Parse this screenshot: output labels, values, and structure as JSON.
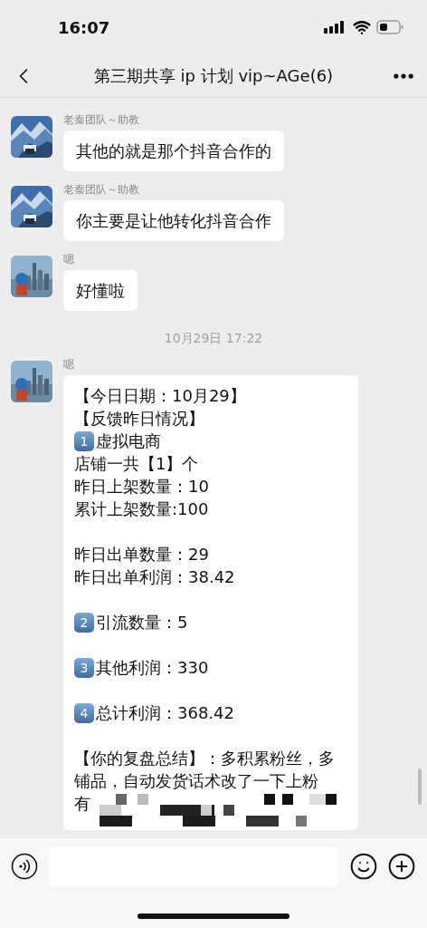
{
  "status_bar": {
    "time": "16:07"
  },
  "header": {
    "title": "第三期共享 ip 计划 vip~AGe(6)"
  },
  "messages": [
    {
      "kind": "bubble",
      "sender": "老秦团队～助教",
      "text": "其他的就是那个抖音合作的"
    },
    {
      "kind": "bubble",
      "sender": "老秦团队～助教",
      "text": "你主要是让他转化抖音合作"
    },
    {
      "kind": "bubble",
      "sender": "嗯",
      "text": "好懂啦"
    },
    {
      "kind": "timestamp",
      "text": "10月29日 17:22"
    },
    {
      "kind": "report",
      "sender": "嗯",
      "lines": [
        {
          "kind": "text",
          "text": "【今日日期：10月29】"
        },
        {
          "kind": "text",
          "text": "【反馈昨日情况】"
        },
        {
          "kind": "numbered",
          "number": "1",
          "text": "虚拟电商"
        },
        {
          "kind": "text",
          "text": "店铺一共【1】个"
        },
        {
          "kind": "text",
          "text": "昨日上架数量：10"
        },
        {
          "kind": "text",
          "text": "累计上架数量:100"
        },
        {
          "kind": "blank"
        },
        {
          "kind": "text",
          "text": "昨日出单数量：29"
        },
        {
          "kind": "text",
          "text": "昨日出单利润：38.42"
        },
        {
          "kind": "blank"
        },
        {
          "kind": "numbered",
          "number": "2",
          "text": "引流数量：5"
        },
        {
          "kind": "blank"
        },
        {
          "kind": "numbered",
          "number": "3",
          "text": "其他利润：330"
        },
        {
          "kind": "blank"
        },
        {
          "kind": "numbered",
          "number": "4",
          "text": "总计利润：368.42"
        },
        {
          "kind": "blank"
        },
        {
          "kind": "text",
          "text": "【你的复盘总结】：多积累粉丝，多铺品，自动发货话术改了一下上粉"
        },
        {
          "kind": "redacted",
          "text": "有"
        }
      ]
    }
  ]
}
